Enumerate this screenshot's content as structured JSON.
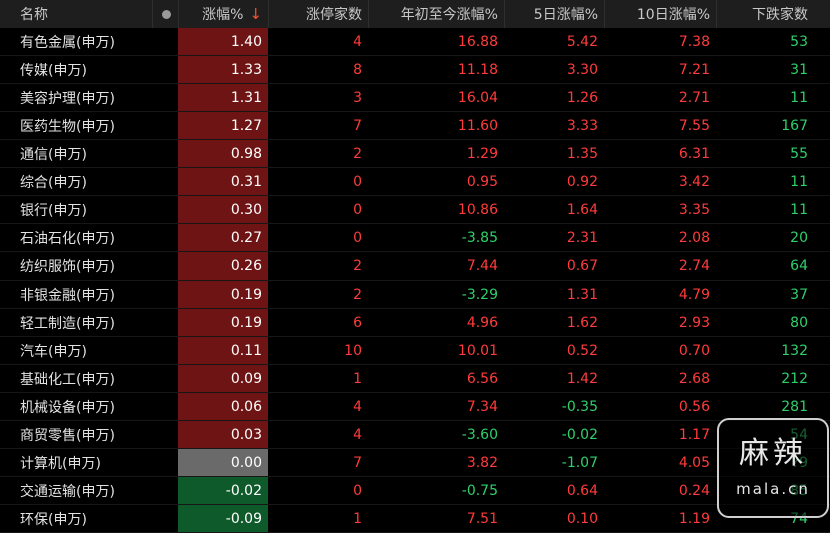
{
  "header": {
    "name": "名称",
    "pct": "涨幅%",
    "pct_sort_arrow": "↓",
    "limit_up": "涨停家数",
    "ytd": "年初至今涨幅%",
    "d5": "5日涨幅%",
    "d10": "10日涨幅%",
    "down_count": "下跌家数"
  },
  "colors": {
    "up": "#ff3b3b",
    "down": "#2fd06a",
    "pct_up_bg": "#6e1414",
    "pct_down_bg": "#0f5a2a",
    "pct_zero_bg": "#6a6a6a"
  },
  "rows": [
    {
      "name": "有色金属(申万)",
      "pct": "1.40",
      "limit_up": "4",
      "ytd": "16.88",
      "d5": "5.42",
      "d10": "7.38",
      "down": "53"
    },
    {
      "name": "传媒(申万)",
      "pct": "1.33",
      "limit_up": "8",
      "ytd": "11.18",
      "d5": "3.30",
      "d10": "7.21",
      "down": "31"
    },
    {
      "name": "美容护理(申万)",
      "pct": "1.31",
      "limit_up": "3",
      "ytd": "16.04",
      "d5": "1.26",
      "d10": "2.71",
      "down": "11"
    },
    {
      "name": "医药生物(申万)",
      "pct": "1.27",
      "limit_up": "7",
      "ytd": "11.60",
      "d5": "3.33",
      "d10": "7.55",
      "down": "167"
    },
    {
      "name": "通信(申万)",
      "pct": "0.98",
      "limit_up": "2",
      "ytd": "1.29",
      "d5": "1.35",
      "d10": "6.31",
      "down": "55"
    },
    {
      "name": "综合(申万)",
      "pct": "0.31",
      "limit_up": "0",
      "ytd": "0.95",
      "d5": "0.92",
      "d10": "3.42",
      "down": "11"
    },
    {
      "name": "银行(申万)",
      "pct": "0.30",
      "limit_up": "0",
      "ytd": "10.86",
      "d5": "1.64",
      "d10": "3.35",
      "down": "11"
    },
    {
      "name": "石油石化(申万)",
      "pct": "0.27",
      "limit_up": "0",
      "ytd": "-3.85",
      "d5": "2.31",
      "d10": "2.08",
      "down": "20"
    },
    {
      "name": "纺织服饰(申万)",
      "pct": "0.26",
      "limit_up": "2",
      "ytd": "7.44",
      "d5": "0.67",
      "d10": "2.74",
      "down": "64"
    },
    {
      "name": "非银金融(申万)",
      "pct": "0.19",
      "limit_up": "2",
      "ytd": "-3.29",
      "d5": "1.31",
      "d10": "4.79",
      "down": "37"
    },
    {
      "name": "轻工制造(申万)",
      "pct": "0.19",
      "limit_up": "6",
      "ytd": "4.96",
      "d5": "1.62",
      "d10": "2.93",
      "down": "80"
    },
    {
      "name": "汽车(申万)",
      "pct": "0.11",
      "limit_up": "10",
      "ytd": "10.01",
      "d5": "0.52",
      "d10": "0.70",
      "down": "132"
    },
    {
      "name": "基础化工(申万)",
      "pct": "0.09",
      "limit_up": "1",
      "ytd": "6.56",
      "d5": "1.42",
      "d10": "2.68",
      "down": "212"
    },
    {
      "name": "机械设备(申万)",
      "pct": "0.06",
      "limit_up": "4",
      "ytd": "7.34",
      "d5": "-0.35",
      "d10": "0.56",
      "down": "281"
    },
    {
      "name": "商贸零售(申万)",
      "pct": "0.03",
      "limit_up": "4",
      "ytd": "-3.60",
      "d5": "-0.02",
      "d10": "1.17",
      "down": "54"
    },
    {
      "name": "计算机(申万)",
      "pct": "0.00",
      "limit_up": "7",
      "ytd": "3.82",
      "d5": "-1.07",
      "d10": "4.05",
      "down": "?9"
    },
    {
      "name": "交通运输(申万)",
      "pct": "-0.02",
      "limit_up": "0",
      "ytd": "-0.75",
      "d5": "0.64",
      "d10": "0.24",
      "down": "85"
    },
    {
      "name": "环保(申万)",
      "pct": "-0.09",
      "limit_up": "1",
      "ytd": "7.51",
      "d5": "0.10",
      "d10": "1.19",
      "down": "74"
    }
  ],
  "watermark": {
    "big": "麻辣",
    "small": "mala.cn"
  }
}
